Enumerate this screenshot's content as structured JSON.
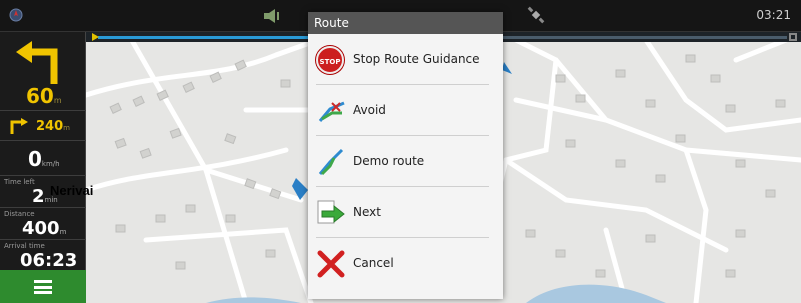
{
  "status_bar": {
    "time": "03:21"
  },
  "route_progress": 0.33,
  "left_panel": {
    "next_turn_distance": "60",
    "next_turn_unit": "m",
    "second_turn_distance": "240",
    "second_turn_unit": "m",
    "speed": "0",
    "speed_unit": "km/h",
    "time_left_label": "Time left",
    "time_left_value": "2",
    "time_left_unit": "min",
    "distance_label": "Distance",
    "distance_value": "400",
    "distance_unit": "m",
    "arrival_label": "Arrival time",
    "arrival_value": "06:23",
    "overlay_label": "Nerivai"
  },
  "dialog": {
    "title": "Route",
    "items": [
      {
        "label": "Stop Route Guidance",
        "icon": "stop-sign-icon"
      },
      {
        "label": "Avoid",
        "icon": "avoid-route-icon"
      },
      {
        "label": "Demo route",
        "icon": "demo-route-icon"
      },
      {
        "label": "Next",
        "icon": "next-arrow-icon"
      },
      {
        "label": "Cancel",
        "icon": "cancel-x-icon"
      }
    ],
    "stop_icon_text": "STOP"
  },
  "colors": {
    "menu_button": "#2e8b2e",
    "turn_arrow": "#f0c400",
    "progress": "#2a9bd8",
    "dialog_title": "#555555"
  }
}
